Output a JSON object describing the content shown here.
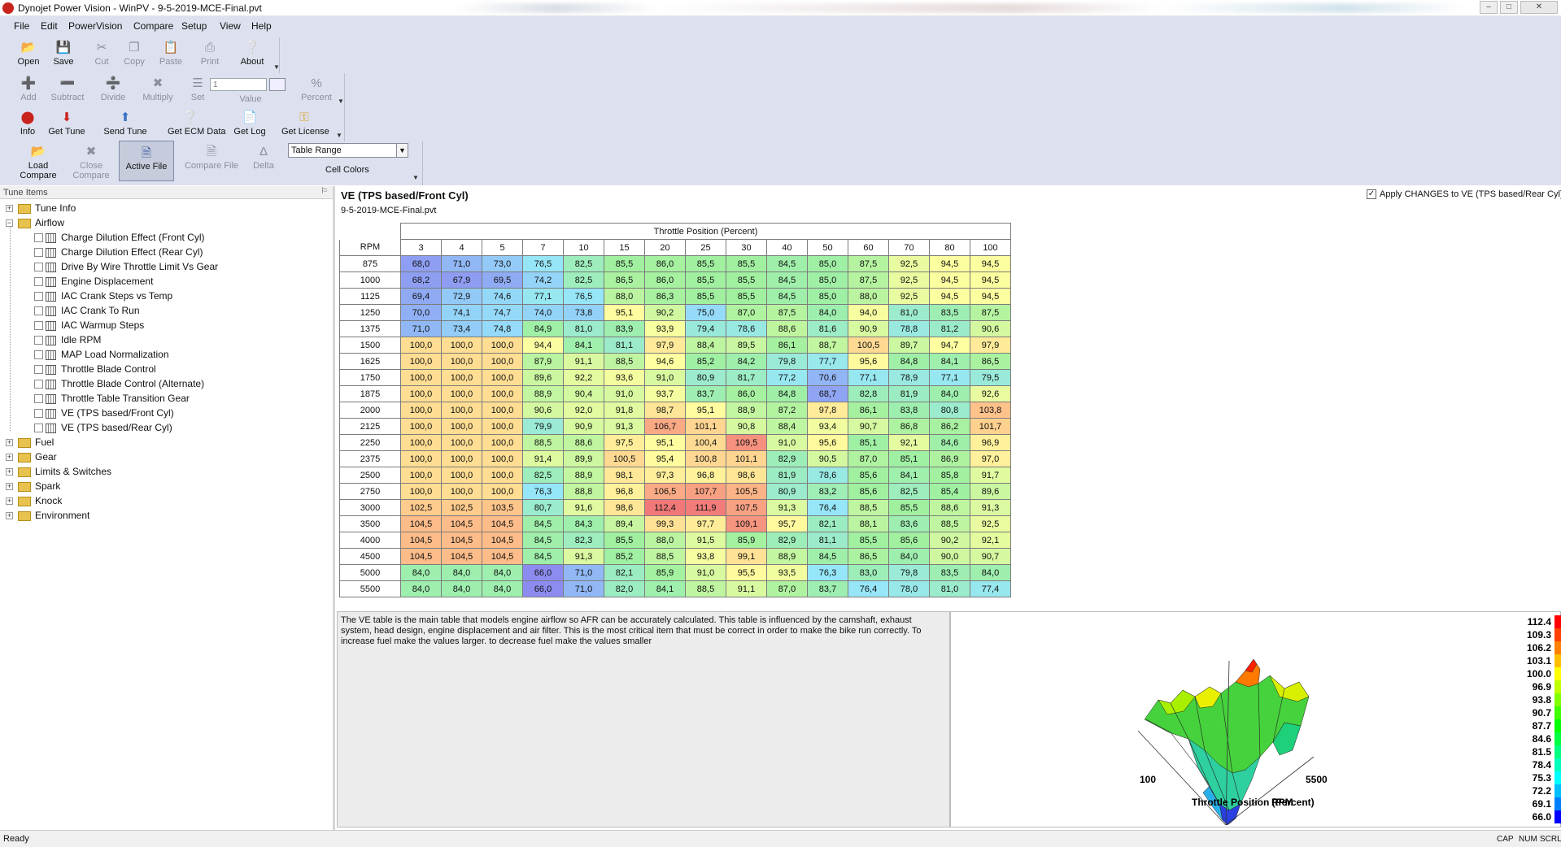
{
  "window": {
    "title": "Dynojet Power Vision - WinPV - 9-5-2019-MCE-Final.pvt"
  },
  "menu": [
    "File",
    "Edit",
    "PowerVision",
    "Compare",
    "Setup",
    "View",
    "Help"
  ],
  "toolbar": {
    "file": [
      {
        "label": "Open"
      },
      {
        "label": "Save"
      },
      {
        "label": "Cut"
      },
      {
        "label": "Copy"
      },
      {
        "label": "Paste"
      },
      {
        "label": "Print"
      },
      {
        "label": "About"
      }
    ],
    "edit": [
      {
        "label": "Add"
      },
      {
        "label": "Subtract"
      },
      {
        "label": "Divide"
      },
      {
        "label": "Multiply"
      },
      {
        "label": "Set"
      },
      {
        "label": "Value"
      },
      {
        "label": "Percent"
      }
    ],
    "value_input": "1",
    "device": [
      {
        "label": "Info"
      },
      {
        "label": "Get Tune"
      },
      {
        "label": "Send Tune"
      },
      {
        "label": "Get ECM Data"
      },
      {
        "label": "Get Log"
      },
      {
        "label": "Get License"
      }
    ],
    "compare": [
      {
        "label": "Load Compare"
      },
      {
        "label": "Close Compare"
      },
      {
        "label": "Active File"
      },
      {
        "label": "Compare File"
      },
      {
        "label": "Delta"
      }
    ],
    "cell_colors_select": "Table Range",
    "cell_colors_label": "Cell Colors"
  },
  "tree": {
    "header": "Tune Items",
    "items": [
      {
        "label": "Tune Info",
        "type": "folder",
        "expanded": false
      },
      {
        "label": "Airflow",
        "type": "folder",
        "expanded": true
      },
      {
        "label": "Charge Dilution Effect (Front Cyl)",
        "type": "table"
      },
      {
        "label": "Charge Dilution Effect (Rear Cyl)",
        "type": "table"
      },
      {
        "label": "Drive By Wire Throttle Limit Vs Gear",
        "type": "table"
      },
      {
        "label": "Engine Displacement",
        "type": "table"
      },
      {
        "label": "IAC Crank Steps vs Temp",
        "type": "table"
      },
      {
        "label": "IAC Crank To Run",
        "type": "table"
      },
      {
        "label": "IAC Warmup Steps",
        "type": "table"
      },
      {
        "label": "Idle RPM",
        "type": "table"
      },
      {
        "label": "MAP Load Normalization",
        "type": "table"
      },
      {
        "label": "Throttle Blade Control",
        "type": "table"
      },
      {
        "label": "Throttle Blade Control (Alternate)",
        "type": "table"
      },
      {
        "label": "Throttle Table Transition Gear",
        "type": "table"
      },
      {
        "label": "VE (TPS based/Front Cyl)",
        "type": "table"
      },
      {
        "label": "VE (TPS based/Rear Cyl)",
        "type": "table"
      },
      {
        "label": "Fuel",
        "type": "folder",
        "expanded": false
      },
      {
        "label": "Gear",
        "type": "folder",
        "expanded": false
      },
      {
        "label": "Limits & Switches",
        "type": "folder",
        "expanded": false
      },
      {
        "label": "Spark",
        "type": "folder",
        "expanded": false
      },
      {
        "label": "Knock",
        "type": "folder",
        "expanded": false
      },
      {
        "label": "Environment",
        "type": "folder",
        "expanded": false
      }
    ]
  },
  "table": {
    "title": "VE (TPS based/Front Cyl)",
    "file": "9-5-2019-MCE-Final.pvt",
    "apply_label": "Apply CHANGES to VE (TPS based/Rear Cyl)",
    "apply_checked": true,
    "column_axis": "Throttle Position (Percent)",
    "row_axis": "RPM",
    "columns": [
      "3",
      "4",
      "5",
      "7",
      "10",
      "15",
      "20",
      "25",
      "30",
      "40",
      "50",
      "60",
      "70",
      "80",
      "100"
    ],
    "rows": [
      {
        "rpm": "875",
        "values": [
          "68,0",
          "71,0",
          "73,0",
          "76,5",
          "82,5",
          "85,5",
          "86,0",
          "85,5",
          "85,5",
          "84,5",
          "85,0",
          "87,5",
          "92,5",
          "94,5",
          "94,5"
        ]
      },
      {
        "rpm": "1000",
        "values": [
          "68,2",
          "67,9",
          "69,5",
          "74,2",
          "82,5",
          "86,5",
          "86,0",
          "85,5",
          "85,5",
          "84,5",
          "85,0",
          "87,5",
          "92,5",
          "94,5",
          "94,5"
        ]
      },
      {
        "rpm": "1125",
        "values": [
          "69,4",
          "72,9",
          "74,6",
          "77,1",
          "76,5",
          "88,0",
          "86,3",
          "85,5",
          "85,5",
          "84,5",
          "85,0",
          "88,0",
          "92,5",
          "94,5",
          "94,5"
        ]
      },
      {
        "rpm": "1250",
        "values": [
          "70,0",
          "74,1",
          "74,7",
          "74,0",
          "73,8",
          "95,1",
          "90,2",
          "75,0",
          "87,0",
          "87,5",
          "84,0",
          "94,0",
          "81,0",
          "83,5",
          "87,5"
        ]
      },
      {
        "rpm": "1375",
        "values": [
          "71,0",
          "73,4",
          "74,8",
          "84,9",
          "81,0",
          "83,9",
          "93,9",
          "79,4",
          "78,6",
          "88,6",
          "81,6",
          "90,9",
          "78,8",
          "81,2",
          "90,6"
        ]
      },
      {
        "rpm": "1500",
        "values": [
          "100,0",
          "100,0",
          "100,0",
          "94,4",
          "84,1",
          "81,1",
          "97,9",
          "88,4",
          "89,5",
          "86,1",
          "88,7",
          "100,5",
          "89,7",
          "94,7",
          "97,9"
        ]
      },
      {
        "rpm": "1625",
        "values": [
          "100,0",
          "100,0",
          "100,0",
          "87,9",
          "91,1",
          "88,5",
          "94,6",
          "85,2",
          "84,2",
          "79,8",
          "77,7",
          "95,6",
          "84,8",
          "84,1",
          "86,5"
        ]
      },
      {
        "rpm": "1750",
        "values": [
          "100,0",
          "100,0",
          "100,0",
          "89,6",
          "92,2",
          "93,6",
          "91,0",
          "80,9",
          "81,7",
          "77,2",
          "70,6",
          "77,1",
          "78,9",
          "77,1",
          "79,5"
        ]
      },
      {
        "rpm": "1875",
        "values": [
          "100,0",
          "100,0",
          "100,0",
          "88,9",
          "90,4",
          "91,0",
          "93,7",
          "83,7",
          "86,0",
          "84,8",
          "68,7",
          "82,8",
          "81,9",
          "84,0",
          "92,6"
        ]
      },
      {
        "rpm": "2000",
        "values": [
          "100,0",
          "100,0",
          "100,0",
          "90,6",
          "92,0",
          "91,8",
          "98,7",
          "95,1",
          "88,9",
          "87,2",
          "97,8",
          "86,1",
          "83,8",
          "80,8",
          "103,8"
        ]
      },
      {
        "rpm": "2125",
        "values": [
          "100,0",
          "100,0",
          "100,0",
          "79,9",
          "90,9",
          "91,3",
          "106,7",
          "101,1",
          "90,8",
          "88,4",
          "93,4",
          "90,7",
          "86,8",
          "86,2",
          "101,7"
        ]
      },
      {
        "rpm": "2250",
        "values": [
          "100,0",
          "100,0",
          "100,0",
          "88,5",
          "88,6",
          "97,5",
          "95,1",
          "100,4",
          "109,5",
          "91,0",
          "95,6",
          "85,1",
          "92,1",
          "84,6",
          "96,9"
        ]
      },
      {
        "rpm": "2375",
        "values": [
          "100,0",
          "100,0",
          "100,0",
          "91,4",
          "89,9",
          "100,5",
          "95,4",
          "100,8",
          "101,1",
          "82,9",
          "90,5",
          "87,0",
          "85,1",
          "86,9",
          "97,0"
        ]
      },
      {
        "rpm": "2500",
        "values": [
          "100,0",
          "100,0",
          "100,0",
          "82,5",
          "88,9",
          "98,1",
          "97,3",
          "96,8",
          "98,6",
          "81,9",
          "78,6",
          "85,6",
          "84,1",
          "85,8",
          "91,7"
        ]
      },
      {
        "rpm": "2750",
        "values": [
          "100,0",
          "100,0",
          "100,0",
          "76,3",
          "88,8",
          "96,8",
          "106,5",
          "107,7",
          "105,5",
          "80,9",
          "83,2",
          "85,6",
          "82,5",
          "85,4",
          "89,6"
        ]
      },
      {
        "rpm": "3000",
        "values": [
          "102,5",
          "102,5",
          "103,5",
          "80,7",
          "91,6",
          "98,6",
          "112,4",
          "111,9",
          "107,5",
          "91,3",
          "76,4",
          "88,5",
          "85,5",
          "88,6",
          "91,3"
        ]
      },
      {
        "rpm": "3500",
        "values": [
          "104,5",
          "104,5",
          "104,5",
          "84,5",
          "84,3",
          "89,4",
          "99,3",
          "97,7",
          "109,1",
          "95,7",
          "82,1",
          "88,1",
          "83,6",
          "88,5",
          "92,5"
        ]
      },
      {
        "rpm": "4000",
        "values": [
          "104,5",
          "104,5",
          "104,5",
          "84,5",
          "82,3",
          "85,5",
          "88,0",
          "91,5",
          "85,9",
          "82,9",
          "81,1",
          "85,5",
          "85,6",
          "90,2",
          "92,1"
        ]
      },
      {
        "rpm": "4500",
        "values": [
          "104,5",
          "104,5",
          "104,5",
          "84,5",
          "91,3",
          "85,2",
          "88,5",
          "93,8",
          "99,1",
          "88,9",
          "84,5",
          "86,5",
          "84,0",
          "90,0",
          "90,7"
        ]
      },
      {
        "rpm": "5000",
        "values": [
          "84,0",
          "84,0",
          "84,0",
          "66,0",
          "71,0",
          "82,1",
          "85,9",
          "91,0",
          "95,5",
          "93,5",
          "76,3",
          "83,0",
          "79,8",
          "83,5",
          "84,0"
        ]
      },
      {
        "rpm": "5500",
        "values": [
          "84,0",
          "84,0",
          "84,0",
          "66,0",
          "71,0",
          "82,0",
          "84,1",
          "88,5",
          "91,1",
          "87,0",
          "83,7",
          "76,4",
          "78,0",
          "81,0",
          "77,4"
        ]
      }
    ]
  },
  "description": "The VE table is the main table that models engine airflow so AFR can be accurately calculated.  This table is influenced by the camshaft, exhaust system, head design, engine displacement and air filter. This is the most critical item that must be correct in order to make the bike run correctly. To increase fuel make the values larger. to decrease fuel make the values smaller",
  "graph": {
    "x_min_label": "100",
    "x_max_label": "5500",
    "axis_label_a": "Throttle Position (Percent)",
    "axis_label_b": "RPM",
    "scale": [
      "112.4",
      "109.3",
      "106.2",
      "103.1",
      "100.0",
      "96.9",
      "93.8",
      "90.7",
      "87.7",
      "84.6",
      "81.5",
      "78.4",
      "75.3",
      "72.2",
      "69.1",
      "66.0"
    ],
    "scale_colors": [
      "#ff0000",
      "#ff4000",
      "#ff8000",
      "#ffbf00",
      "#ffff00",
      "#bfff00",
      "#80ff00",
      "#40ff00",
      "#00ff00",
      "#00ff40",
      "#00ff80",
      "#00ffbf",
      "#00ffff",
      "#00bfff",
      "#0080ff",
      "#0000ff"
    ]
  },
  "status": {
    "text": "Ready",
    "indicators": [
      "CAP",
      "NUM",
      "SCRL"
    ]
  },
  "colors": {
    "ribbon_bg": "#dde1ef",
    "min_cell": "#8e8ef0",
    "mid_cell": "#a0f0a0",
    "high_cell": "#ffffa0",
    "max_cell": "#f08080"
  }
}
